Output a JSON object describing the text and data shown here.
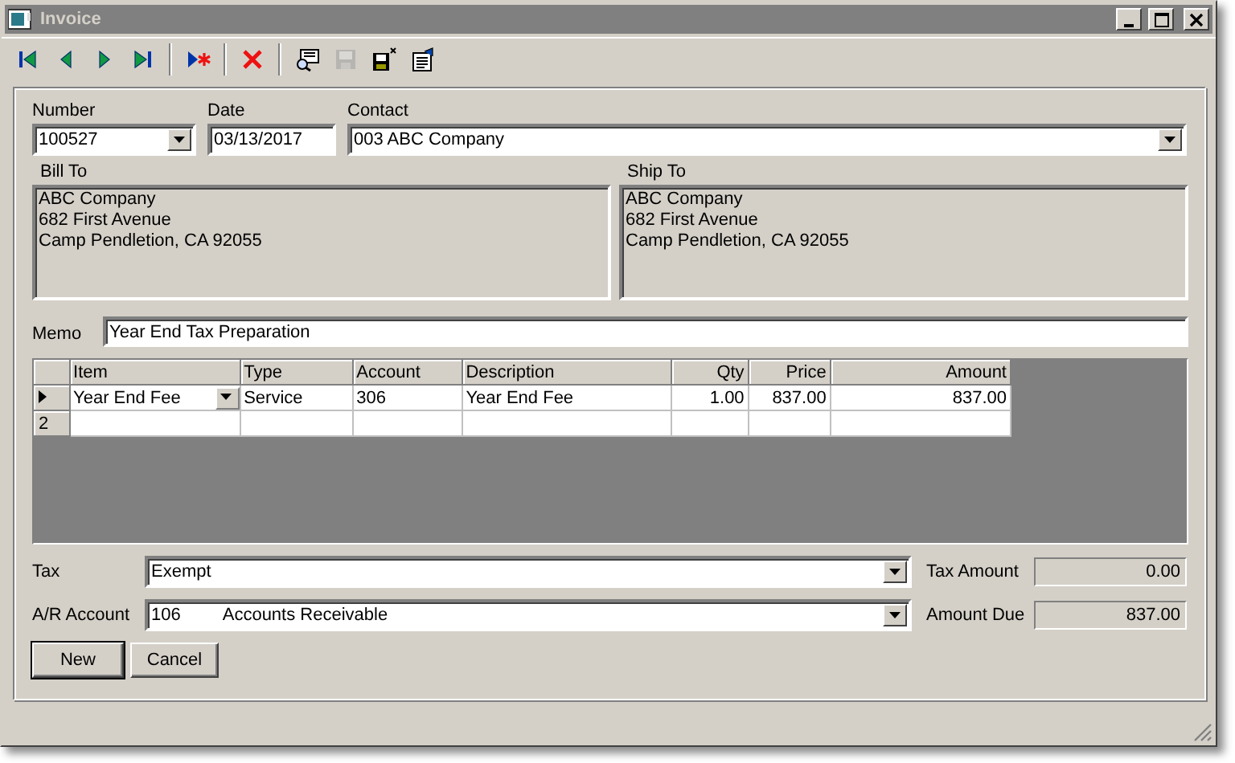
{
  "window": {
    "title": "Invoice",
    "controls": [
      {
        "kind": "minimize"
      },
      {
        "kind": "maximize"
      },
      {
        "kind": "close"
      }
    ]
  },
  "toolbar": {
    "buttons": [
      {
        "kind": "first",
        "disabled": false
      },
      {
        "kind": "previous",
        "disabled": false
      },
      {
        "kind": "next",
        "disabled": false
      },
      {
        "kind": "last",
        "disabled": false
      },
      {
        "kind": "new",
        "disabled": false
      },
      {
        "kind": "delete",
        "disabled": false
      },
      {
        "kind": "preview",
        "disabled": false
      },
      {
        "kind": "save",
        "disabled": true
      },
      {
        "kind": "save_close",
        "disabled": false
      },
      {
        "kind": "properties",
        "disabled": false
      }
    ]
  },
  "number": {
    "label": "Number",
    "value": "100527"
  },
  "date": {
    "label": "Date",
    "value": "03/13/2017"
  },
  "contact": {
    "label": "Contact",
    "value": "003 ABC Company"
  },
  "bill_to": {
    "label": "Bill To",
    "lines": [
      "ABC Company",
      "682 First Avenue",
      "Camp Pendletion, CA 92055"
    ]
  },
  "ship_to": {
    "label": "Ship To",
    "lines": [
      "ABC Company",
      "682 First Avenue",
      "Camp Pendletion, CA 92055"
    ]
  },
  "memo": {
    "label": "Memo",
    "value": "Year End Tax Preparation"
  },
  "grid": {
    "columns": [
      {
        "label": "Item",
        "kind": "text"
      },
      {
        "label": "Type",
        "kind": "text"
      },
      {
        "label": "Account",
        "kind": "text"
      },
      {
        "label": "Description",
        "kind": "text"
      },
      {
        "label": "Qty",
        "kind": "numeric"
      },
      {
        "label": "Price",
        "kind": "numeric"
      },
      {
        "label": "Amount",
        "kind": "numeric"
      }
    ],
    "rows": [
      {
        "current": true,
        "cells": [
          "Year End Fee",
          "Service",
          "306",
          "Year End Fee",
          "1.00",
          "837.00",
          "837.00"
        ]
      },
      {
        "current": false,
        "number": "2"
      }
    ]
  },
  "tax": {
    "label": "Tax",
    "value": "Exempt"
  },
  "ar_account": {
    "label": "A/R Account",
    "code": "106",
    "name": "Accounts Receivable"
  },
  "tax_amount": {
    "label": "Tax Amount",
    "value": "0.00"
  },
  "amount_due": {
    "label": "Amount Due",
    "value": "837.00"
  },
  "buttons": [
    {
      "label": "New",
      "default": true
    },
    {
      "label": "Cancel",
      "default": false
    }
  ]
}
